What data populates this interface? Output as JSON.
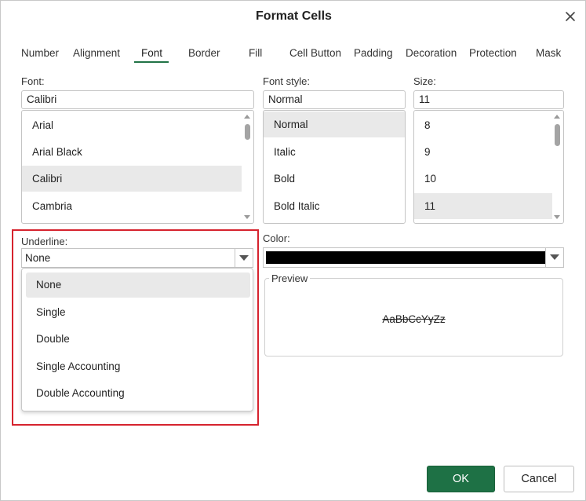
{
  "dialog": {
    "title": "Format Cells"
  },
  "tabs": [
    {
      "label": "Number"
    },
    {
      "label": "Alignment"
    },
    {
      "label": "Font"
    },
    {
      "label": "Border"
    },
    {
      "label": "Fill"
    },
    {
      "label": "Cell Button"
    },
    {
      "label": "Padding"
    },
    {
      "label": "Decoration"
    },
    {
      "label": "Protection"
    },
    {
      "label": "Mask"
    }
  ],
  "active_tab": "Font",
  "font": {
    "label": "Font:",
    "value": "Calibri",
    "items": [
      "Arial",
      "Arial Black",
      "Calibri",
      "Cambria"
    ],
    "selected": "Calibri"
  },
  "font_style": {
    "label": "Font style:",
    "value": "Normal",
    "items": [
      "Normal",
      "Italic",
      "Bold",
      "Bold Italic"
    ],
    "selected": "Normal"
  },
  "size": {
    "label": "Size:",
    "value": "11",
    "items": [
      "8",
      "9",
      "10",
      "11"
    ],
    "selected": "11"
  },
  "underline": {
    "label": "Underline:",
    "value": "None",
    "options": [
      "None",
      "Single",
      "Double",
      "Single Accounting",
      "Double Accounting"
    ],
    "selected": "None"
  },
  "color": {
    "label": "Color:",
    "value": "#000000"
  },
  "preview": {
    "legend": "Preview",
    "sample": "AaBbCcYyZz"
  },
  "buttons": {
    "ok": "OK",
    "cancel": "Cancel"
  },
  "colors": {
    "accent": "#217346",
    "ok_button": "#1e7145",
    "highlight_border": "#d6232e",
    "selection": "#e9e9e9"
  },
  "icons": {
    "close": "close-icon",
    "dropdown": "chevron-down-icon"
  }
}
